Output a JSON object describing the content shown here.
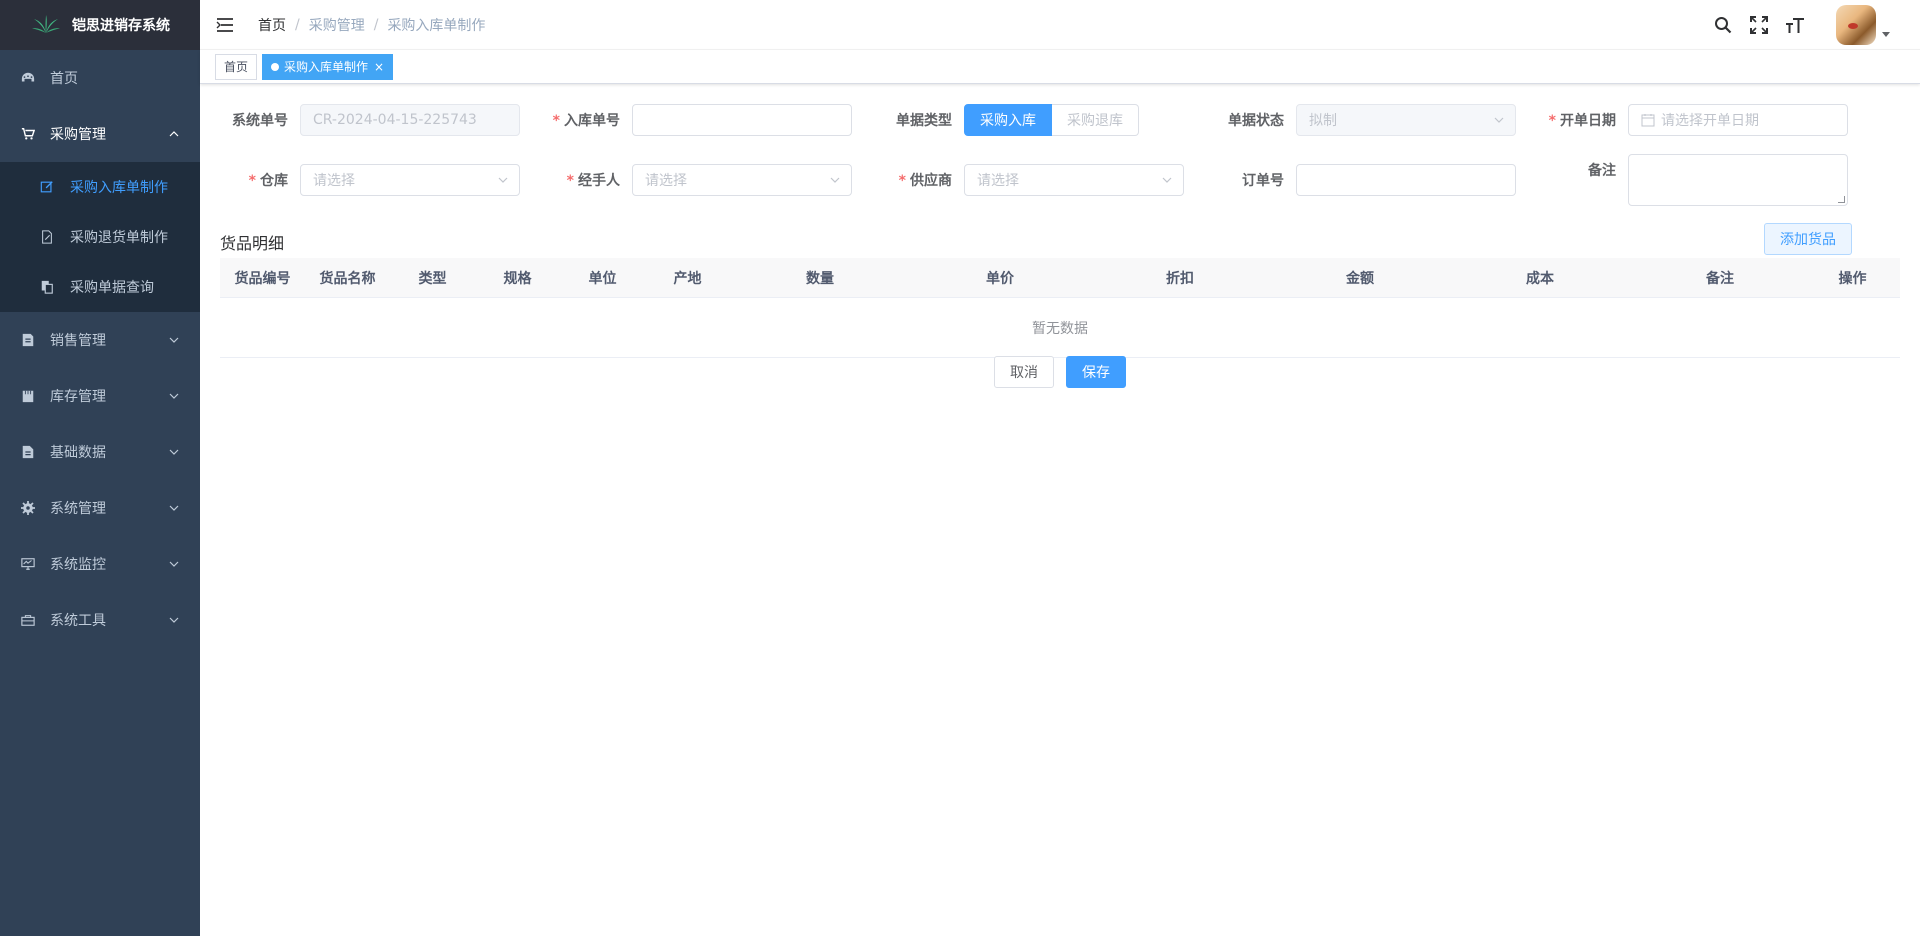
{
  "app": {
    "title": "铠思进销存系统"
  },
  "sidebar": {
    "items": [
      {
        "label": "首页",
        "icon": "dashboard-icon"
      },
      {
        "label": "采购管理",
        "icon": "cart-icon",
        "opened": true,
        "children": [
          {
            "label": "采购入库单制作",
            "icon": "edit-icon",
            "active": true
          },
          {
            "label": "采购退货单制作",
            "icon": "edit-doc-icon"
          },
          {
            "label": "采购单据查询",
            "icon": "copy-icon"
          }
        ]
      },
      {
        "label": "销售管理",
        "icon": "sales-icon"
      },
      {
        "label": "库存管理",
        "icon": "warehouse-icon"
      },
      {
        "label": "基础数据",
        "icon": "data-icon"
      },
      {
        "label": "系统管理",
        "icon": "gear-icon"
      },
      {
        "label": "系统监控",
        "icon": "monitor-icon"
      },
      {
        "label": "系统工具",
        "icon": "toolbox-icon"
      }
    ]
  },
  "breadcrumb": {
    "items": [
      "首页",
      "采购管理",
      "采购入库单制作"
    ],
    "sep": "/"
  },
  "tags": {
    "home": "首页",
    "current": "采购入库单制作",
    "close": "×"
  },
  "form": {
    "system_no": {
      "label": "系统单号",
      "value": "CR-2024-04-15-225743"
    },
    "inbound_no": {
      "label": "入库单号",
      "value": ""
    },
    "doc_type": {
      "label": "单据类型",
      "options": [
        "采购入库",
        "采购退库"
      ],
      "selected": "采购入库"
    },
    "doc_status": {
      "label": "单据状态",
      "value": "拟制"
    },
    "open_date": {
      "label": "开单日期",
      "placeholder": "请选择开单日期"
    },
    "warehouse": {
      "label": "仓库",
      "placeholder": "请选择"
    },
    "handler": {
      "label": "经手人",
      "placeholder": "请选择"
    },
    "supplier": {
      "label": "供应商",
      "placeholder": "请选择"
    },
    "order_no": {
      "label": "订单号",
      "value": ""
    },
    "remark": {
      "label": "备注",
      "value": ""
    },
    "required_mark": "*"
  },
  "goods": {
    "title": "货品明细",
    "add_label": "添加货品",
    "columns": [
      "货品编号",
      "货品名称",
      "类型",
      "规格",
      "单位",
      "产地",
      "数量",
      "单价",
      "折扣",
      "金额",
      "成本",
      "备注",
      "操作"
    ],
    "empty_text": "暂无数据"
  },
  "actions": {
    "cancel": "取消",
    "save": "保存"
  },
  "colors": {
    "sidebar_bg": "#304156",
    "primary": "#409eff",
    "tag_active": "#42a5f5"
  }
}
